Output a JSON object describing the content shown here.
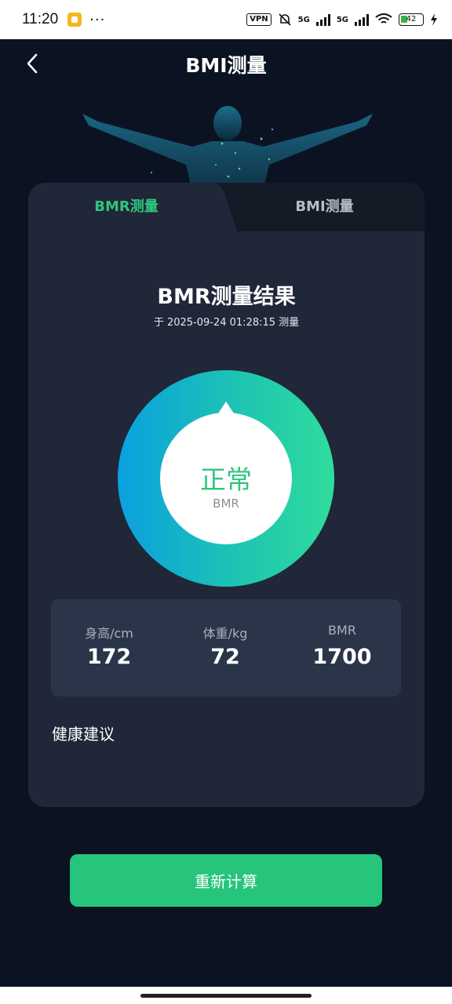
{
  "status_bar": {
    "time": "11:20",
    "dots": "···",
    "vpn": "VPN",
    "net1": "5G",
    "net2": "5G",
    "battery": "42"
  },
  "header": {
    "title": "BMI测量"
  },
  "tabs": [
    {
      "label": "BMR测量",
      "active": true
    },
    {
      "label": "BMI测量",
      "active": false
    }
  ],
  "result": {
    "title": "BMR测量结果",
    "measured_at": "于 2025-09-24 01:28:15 测量",
    "status": "正常",
    "status_label": "BMR"
  },
  "stats": [
    {
      "label": "身高/cm",
      "value": "172"
    },
    {
      "label": "体重/kg",
      "value": "72"
    },
    {
      "label": "BMR",
      "value": "1700"
    }
  ],
  "advice": {
    "heading": "健康建议"
  },
  "actions": {
    "recalculate": "重新计算"
  },
  "colors": {
    "accent_green": "#27c47c",
    "gauge_start": "#0aa0e0",
    "gauge_end": "#2fdc9c",
    "card_bg": "#1f2738",
    "page_bg": "#0b1322"
  }
}
